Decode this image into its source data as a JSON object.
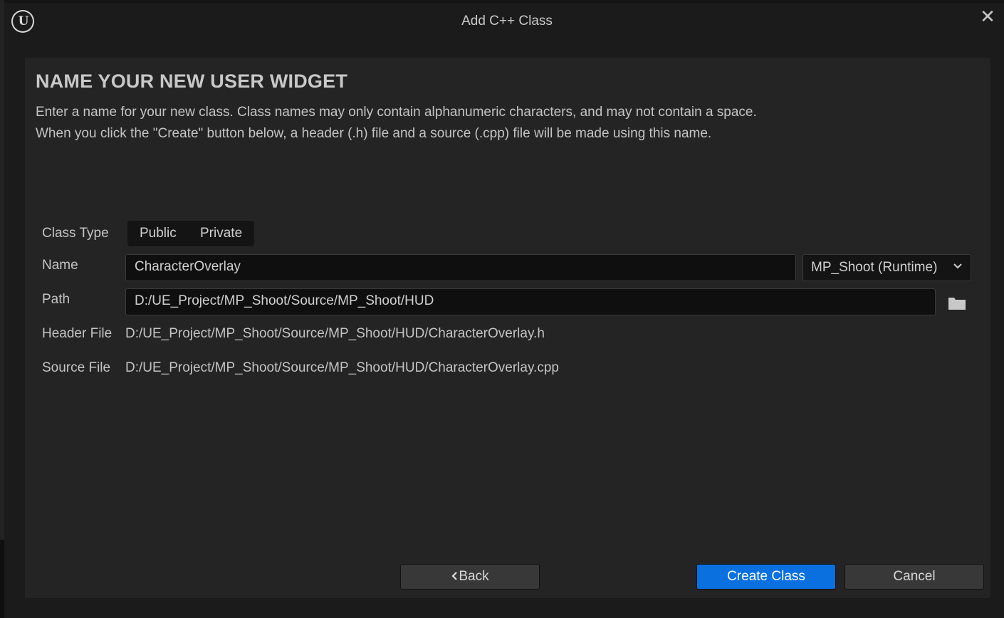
{
  "window": {
    "title": "Add C++ Class",
    "logo_text": "U",
    "close_glyph": "✕"
  },
  "page": {
    "heading": "NAME YOUR NEW USER WIDGET",
    "desc_line1": "Enter a name for your new class. Class names may only contain alphanumeric characters, and may not contain a space.",
    "desc_line2": "When you click the \"Create\" button below, a header (.h) file and a source (.cpp) file will be made using this name."
  },
  "form": {
    "class_type_label": "Class Type",
    "class_type_options": [
      "Public",
      "Private"
    ],
    "name_label": "Name",
    "name_value": "CharacterOverlay",
    "module_value": "MP_Shoot (Runtime)",
    "path_label": "Path",
    "path_value": "D:/UE_Project/MP_Shoot/Source/MP_Shoot/HUD",
    "header_label": "Header File",
    "header_value": "D:/UE_Project/MP_Shoot/Source/MP_Shoot/HUD/CharacterOverlay.h",
    "source_label": "Source File",
    "source_value": "D:/UE_Project/MP_Shoot/Source/MP_Shoot/HUD/CharacterOverlay.cpp"
  },
  "buttons": {
    "back": "Back",
    "create": "Create Class",
    "cancel": "Cancel"
  },
  "colors": {
    "accent": "#0a70e0",
    "panel": "#242424",
    "window": "#1b1b1b"
  },
  "icons": {
    "logo": "unreal-engine-logo-icon",
    "close": "close-icon",
    "dropdown": "chevron-down-icon",
    "folder": "folder-icon",
    "back": "chevron-left-icon"
  }
}
